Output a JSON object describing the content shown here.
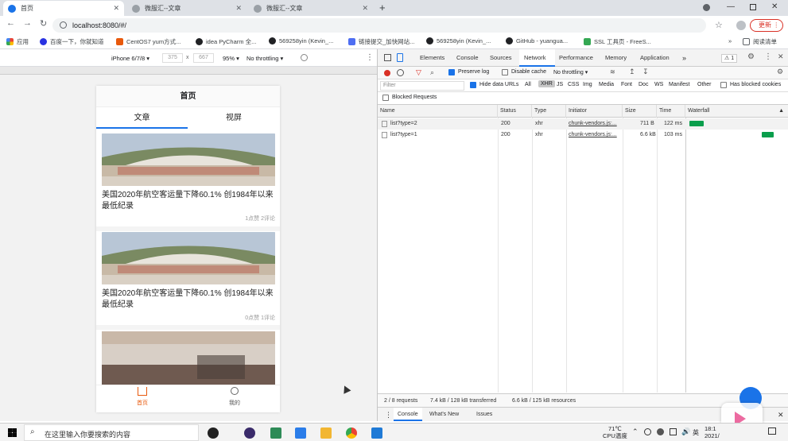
{
  "browser": {
    "tabs": [
      {
        "label": "首页",
        "active": true
      },
      {
        "label": "微服汇--文章",
        "active": false
      },
      {
        "label": "微服汇--文章",
        "active": false
      }
    ],
    "url": "localhost:8080/#/",
    "update_label": "更新",
    "bookmarks": [
      "应用",
      "百度一下，你就知道",
      "CentOS7 yum方式...",
      "idea PyCharm 全...",
      "569258yin (Kevin_...",
      "链接提交_加快网站...",
      "569258yin (Kevin_...",
      "GitHub - yuangua...",
      "SSL 工具页 - FreeS..."
    ],
    "bookmarks_more": "»",
    "reading_list": "阅读清单"
  },
  "device_toolbar": {
    "device": "iPhone 6/7/8 ▾",
    "width": "375",
    "times": "x",
    "height": "667",
    "zoom": "95% ▾",
    "throttle": "No throttling ▾"
  },
  "app": {
    "header_title": "首页",
    "tabs": [
      "文章",
      "视屏"
    ],
    "articles": [
      {
        "title": "美国2020年航空客运量下降60.1% 创1984年以来最低纪录",
        "meta": "1点赞 2评论"
      },
      {
        "title": "美国2020年航空客运量下降60.1% 创1984年以来最低纪录",
        "meta": "0点赞 1评论"
      }
    ],
    "nav": [
      "首页",
      "我的"
    ]
  },
  "devtools": {
    "tabs": [
      "Elements",
      "Console",
      "Sources",
      "Network",
      "Performance",
      "Memory",
      "Application",
      "»"
    ],
    "active_tab": "Network",
    "warning_count": "1",
    "preserve_log": "Preserve log",
    "disable_cache": "Disable cache",
    "throttling": "No throttling",
    "filter_placeholder": "Filter",
    "hide_data_urls": "Hide data URLs",
    "filter_types": [
      "All",
      "XHR",
      "JS",
      "CSS",
      "Img",
      "Media",
      "Font",
      "Doc",
      "WS",
      "Manifest",
      "Other"
    ],
    "has_blocked_cookies": "Has blocked cookies",
    "blocked_requests": "Blocked Requests",
    "columns": [
      "Name",
      "Status",
      "Type",
      "Initiator",
      "Size",
      "Time",
      "Waterfall"
    ],
    "rows": [
      {
        "name": "list?type=2",
        "status": "200",
        "type": "xhr",
        "initiator": "chunk-vendors.js:...",
        "size": "711 B",
        "time": "122 ms"
      },
      {
        "name": "list?type=1",
        "status": "200",
        "type": "xhr",
        "initiator": "chunk-vendors.js:...",
        "size": "6.6 kB",
        "time": "103 ms"
      }
    ],
    "status_bar": [
      "2 / 8 requests",
      "7.4 kB / 128 kB transferred",
      "6.6 kB / 125 kB resources"
    ],
    "drawer_tabs": [
      "Console",
      "What's New",
      "Issues"
    ]
  },
  "taskbar": {
    "search_placeholder": "在这里输入你要搜索的内容",
    "temp": "71℃",
    "cpu": "CPU温度",
    "ime": "英",
    "time": "18:1",
    "date": "2021/"
  },
  "colors": {
    "accent": "#1a73e8",
    "chrome_bg": "#dee1e6",
    "update": "#d93025",
    "waterfall": "#0a9e4c"
  }
}
